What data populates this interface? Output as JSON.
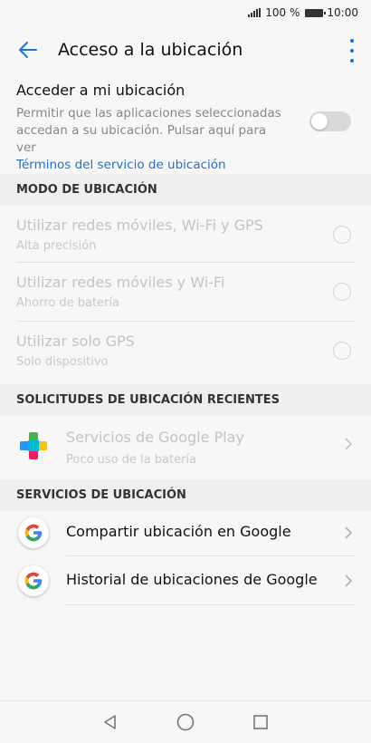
{
  "status_bar": {
    "signal_icon": "signal-icon",
    "battery_percent": "100 %",
    "battery_icon": "battery-icon",
    "time": "10:00"
  },
  "header": {
    "back_icon": "arrow-left-icon",
    "title": "Acceso a la ubicación",
    "menu_icon": "more-vert-icon"
  },
  "location_access": {
    "title": "Acceder a mi ubicación",
    "description": "Permitir que las aplicaciones seleccionadas accedan a su ubicación. Pulsar aquí para ver",
    "link": "Términos del servicio de ubicación",
    "toggle_on": false
  },
  "mode_section": {
    "header": "MODO DE UBICACIÓN",
    "options": [
      {
        "title": "Utilizar redes móviles, Wi-Fi y GPS",
        "subtitle": "Alta precisión",
        "selected": false
      },
      {
        "title": "Utilizar redes móviles y Wi-Fi",
        "subtitle": "Ahorro de batería",
        "selected": false
      },
      {
        "title": "Utilizar solo GPS",
        "subtitle": "Solo dispositivo",
        "selected": false
      }
    ]
  },
  "recent_section": {
    "header": "SOLICITUDES DE UBICACIÓN RECIENTES",
    "apps": [
      {
        "title": "Servicios de Google Play",
        "subtitle": "Poco uso de la batería",
        "icon": "google-play-services-icon"
      }
    ]
  },
  "services_section": {
    "header": "SERVICIOS DE UBICACIÓN",
    "items": [
      {
        "title": "Compartir ubicación en Google",
        "icon": "google-icon"
      },
      {
        "title": "Historial de ubicaciones de Google",
        "icon": "google-icon"
      }
    ]
  },
  "nav_bar": {
    "back": "nav-back-icon",
    "home": "nav-home-icon",
    "recents": "nav-recents-icon"
  },
  "colors": {
    "accent": "#1976d2",
    "link": "#1e73c8",
    "disabled_text": "#c4c4c4",
    "section_bg": "#efefef"
  }
}
